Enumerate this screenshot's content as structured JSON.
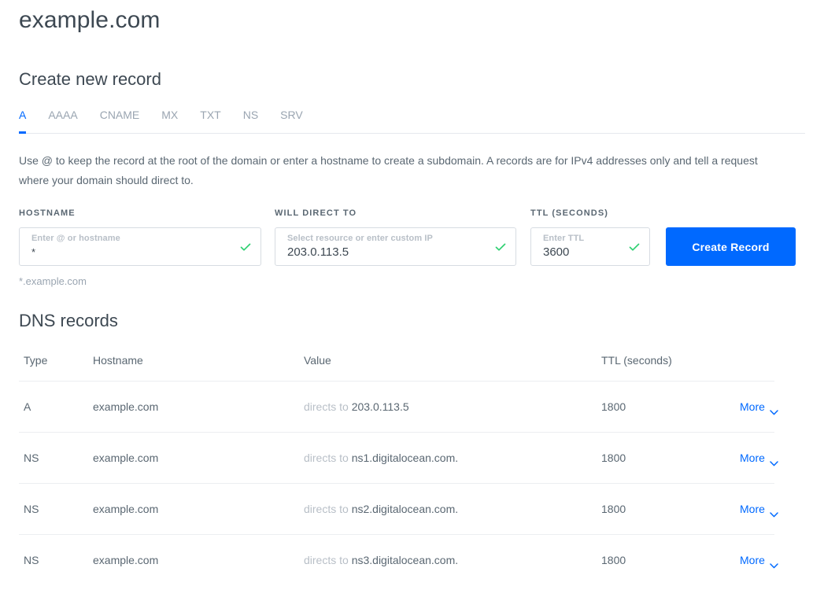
{
  "page_title": "example.com",
  "create_section": {
    "heading": "Create new record",
    "tabs": [
      {
        "label": "A",
        "active": true
      },
      {
        "label": "AAAA",
        "active": false
      },
      {
        "label": "CNAME",
        "active": false
      },
      {
        "label": "MX",
        "active": false
      },
      {
        "label": "TXT",
        "active": false
      },
      {
        "label": "NS",
        "active": false
      },
      {
        "label": "SRV",
        "active": false
      }
    ],
    "description": "Use @ to keep the record at the root of the domain or enter a hostname to create a subdomain. A records are for IPv4 addresses only and tell a request where your domain should direct to.",
    "fields": {
      "hostname": {
        "label": "HOSTNAME",
        "placeholder": "Enter @ or hostname",
        "value": "*",
        "helper": "*.example.com",
        "valid": true
      },
      "direct_to": {
        "label": "WILL DIRECT TO",
        "placeholder": "Select resource or enter custom IP",
        "value": "203.0.113.5",
        "valid": true
      },
      "ttl": {
        "label": "TTL (SECONDS)",
        "placeholder": "Enter TTL",
        "value": "3600",
        "valid": true
      }
    },
    "submit_label": "Create Record"
  },
  "records_section": {
    "heading": "DNS records",
    "columns": [
      "Type",
      "Hostname",
      "Value",
      "TTL (seconds)"
    ],
    "value_prefix": "directs to",
    "more_label": "More",
    "rows": [
      {
        "type": "A",
        "hostname": "example.com",
        "value": "203.0.113.5",
        "ttl": "1800"
      },
      {
        "type": "NS",
        "hostname": "example.com",
        "value": "ns1.digitalocean.com.",
        "ttl": "1800"
      },
      {
        "type": "NS",
        "hostname": "example.com",
        "value": "ns2.digitalocean.com.",
        "ttl": "1800"
      },
      {
        "type": "NS",
        "hostname": "example.com",
        "value": "ns3.digitalocean.com.",
        "ttl": "1800"
      }
    ]
  },
  "colors": {
    "accent_blue": "#0069ff",
    "valid_green": "#2fd072",
    "text_dark": "#3d4852",
    "text_muted": "#5a6772",
    "text_placeholder": "#b8bfc7"
  }
}
